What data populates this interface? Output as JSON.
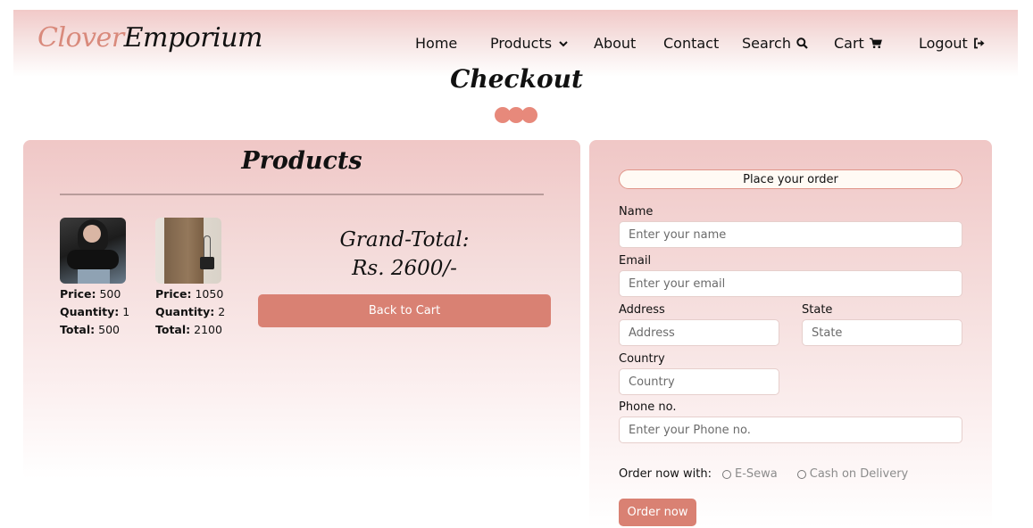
{
  "brand": {
    "part1": "Clover",
    "part2": "Emporium"
  },
  "nav": {
    "home": "Home",
    "products": "Products",
    "about": "About",
    "contact": "Contact",
    "search": "Search",
    "cart": "Cart",
    "logout": "Logout"
  },
  "page_title": "Checkout",
  "products_panel": {
    "title": "Products",
    "items": [
      {
        "price_label": "Price:",
        "price": "500",
        "qty_label": "Quantity:",
        "qty": "1",
        "total_label": "Total:",
        "total": "500"
      },
      {
        "price_label": "Price:",
        "price": "1050",
        "qty_label": "Quantity:",
        "qty": "2",
        "total_label": "Total:",
        "total": "2100"
      }
    ],
    "grand_total_label": "Grand-Total:",
    "grand_total_value": "Rs. 2600/-",
    "back_button": "Back to Cart"
  },
  "form": {
    "heading": "Place your order",
    "name_label": "Name",
    "name_placeholder": "Enter your name",
    "email_label": "Email",
    "email_placeholder": "Enter your email",
    "address_label": "Address",
    "address_placeholder": "Address",
    "state_label": "State",
    "state_placeholder": "State",
    "country_label": "Country",
    "country_placeholder": "Country",
    "phone_label": "Phone no.",
    "phone_placeholder": "Enter your Phone no.",
    "order_with_label": "Order now with:",
    "payment_options": [
      "E-Sewa",
      "Cash on Delivery"
    ],
    "order_button": "Order now"
  },
  "colors": {
    "accent": "#d98173",
    "brand_pink": "#d98a7c",
    "panel_top": "#f0c7c6"
  },
  "icons": {
    "products": "chevron-down-icon",
    "search": "search-icon",
    "cart": "cart-icon",
    "logout": "logout-icon"
  }
}
